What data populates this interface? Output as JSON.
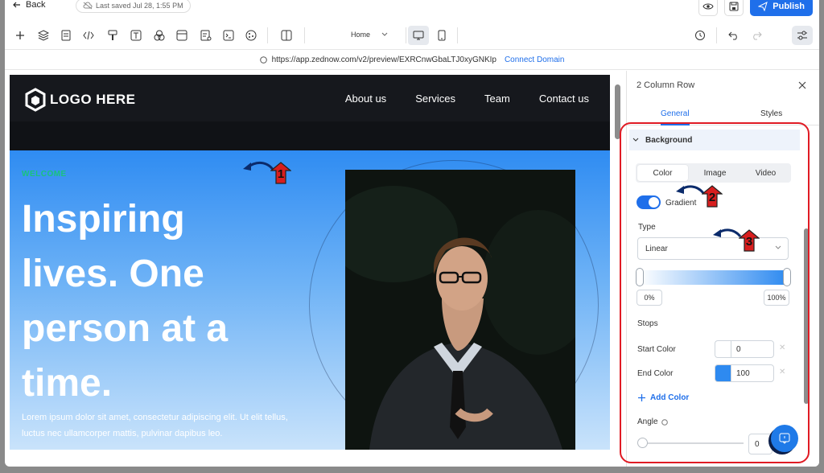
{
  "topbar": {
    "back_label": "Back",
    "saved_text": "Last saved Jul 28, 1:55 PM",
    "publish_label": "Publish"
  },
  "toolbar": {
    "page_select": "Home",
    "tools": [
      "plus-icon",
      "layers-icon",
      "page-icon",
      "code-icon",
      "paint-icon",
      "text-icon",
      "shapes-icon",
      "layout-icon",
      "form-icon",
      "terminal-icon",
      "cookie-icon",
      "columns-icon"
    ],
    "devices": [
      "desktop-icon",
      "mobile-icon"
    ]
  },
  "urlbar": {
    "url": "https://app.zednow.com/v2/preview/EXRCnwGbaLTJ0xyGNKIp",
    "connect_label": "Connect Domain"
  },
  "site": {
    "logo_text": "LOGO HERE",
    "nav": [
      "About us",
      "Services",
      "Team",
      "Contact us"
    ],
    "welcome": "WELCOME",
    "headline": "Inspiring lives. One person at a time.",
    "lorem": "Lorem ipsum dolor sit amet, consectetur adipiscing elit. Ut elit tellus, luctus nec ullamcorper mattis, pulvinar dapibus leo."
  },
  "panel": {
    "title": "2 Column Row",
    "tabs": [
      "General",
      "Styles"
    ],
    "active_tab": "General",
    "section": "Background",
    "bg_tabs": [
      "Color",
      "Image",
      "Video"
    ],
    "active_bg_tab": "Color",
    "gradient_label": "Gradient",
    "gradient_on": true,
    "type_label": "Type",
    "type_value": "Linear",
    "start_pct": "0%",
    "end_pct": "100%",
    "stops_label": "Stops",
    "start_color_label": "Start Color",
    "start_color_value": "0",
    "end_color_label": "End Color",
    "end_color_value": "100",
    "add_color_label": "Add Color",
    "angle_label": "Angle",
    "angle_value": "0"
  },
  "annotations": [
    "1",
    "2",
    "3"
  ],
  "colors": {
    "accent": "#1f6fea",
    "highlight": "#e01b24",
    "welcome": "#19c37d",
    "gradient_end": "#2e8af0"
  }
}
